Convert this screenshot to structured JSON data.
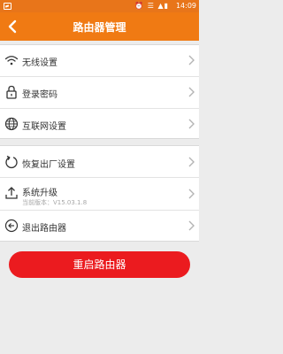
{
  "status_bar": {
    "icons": "⏰ ☰ ▲▮",
    "time": "14:09"
  },
  "header": {
    "title": "路由器管理"
  },
  "menu_group_1": [
    {
      "label": "无线设置",
      "icon": "wifi-icon"
    },
    {
      "label": "登录密码",
      "icon": "lock-icon"
    },
    {
      "label": "互联网设置",
      "icon": "globe-icon"
    }
  ],
  "menu_group_2": [
    {
      "label": "恢复出厂设置",
      "icon": "restore-icon"
    },
    {
      "label": "系统升级",
      "icon": "upload-icon",
      "sub": "当前版本：V15.03.1.8"
    },
    {
      "label": "退出路由器",
      "icon": "exit-icon"
    }
  ],
  "reboot_button": {
    "label": "重启路由器"
  },
  "colors": {
    "header": "#f07a13",
    "button": "#eb1b1f"
  }
}
